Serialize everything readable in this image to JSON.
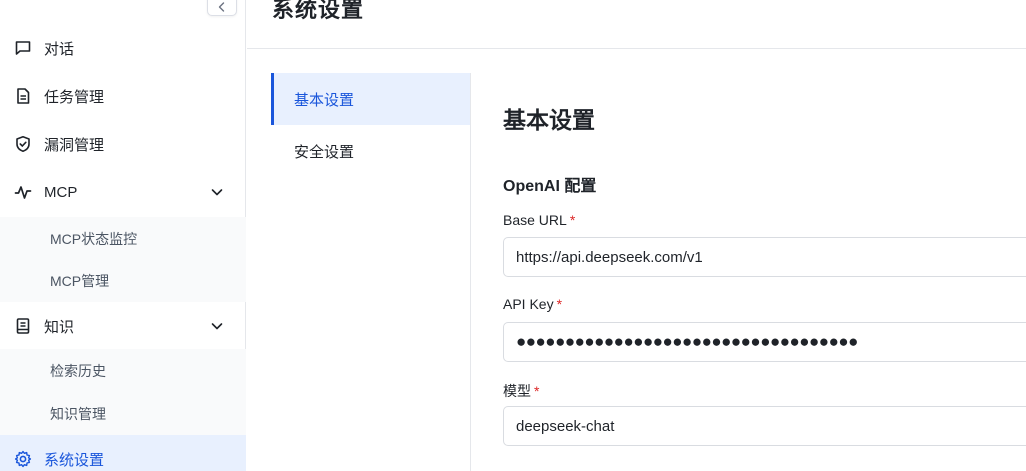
{
  "sidebar": {
    "items": [
      {
        "label": "对话",
        "icon": "chat-bubble-icon"
      },
      {
        "label": "任务管理",
        "icon": "document-icon"
      },
      {
        "label": "漏洞管理",
        "icon": "shield-check-icon"
      },
      {
        "label": "MCP",
        "icon": "activity-pulse-icon"
      },
      {
        "label": "知识",
        "icon": "book-list-icon"
      },
      {
        "label": "系统设置",
        "icon": "gear-icon"
      }
    ],
    "mcp_sub": [
      "MCP状态监控",
      "MCP管理"
    ],
    "knowledge_sub": [
      "检索历史",
      "知识管理"
    ]
  },
  "header": {
    "title": "系统设置"
  },
  "settings_nav": [
    "基本设置",
    "安全设置"
  ],
  "form": {
    "section_title": "基本设置",
    "group_title": "OpenAI 配置",
    "base_url": {
      "label": "Base URL",
      "required": "*",
      "value": "https://api.deepseek.com/v1"
    },
    "api_key": {
      "label": "API Key",
      "required": "*",
      "value": "●●●●●●●●●●●●●●●●●●●●●●●●●●●●●●●●●●●"
    },
    "model": {
      "label": "模型",
      "required": "*",
      "value": "deepseek-chat"
    }
  },
  "colors": {
    "accent": "#1a56db",
    "active_bg": "#e8f0fe",
    "required": "#dc2626"
  }
}
